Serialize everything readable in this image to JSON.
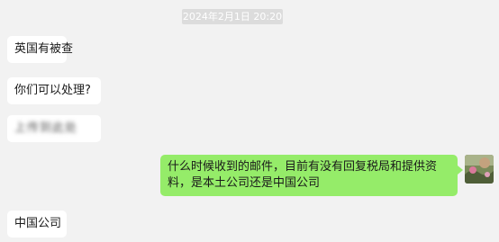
{
  "chat": {
    "timestamp": "2024年2月1日 20:20",
    "messages": [
      {
        "side": "incoming",
        "text": "英国有被查"
      },
      {
        "side": "incoming",
        "text": "你们可以处理?"
      },
      {
        "side": "incoming",
        "text": "上传到此处",
        "obscured": true
      },
      {
        "side": "outgoing",
        "text": "什么时候收到的邮件，目前有没有回复税局和提供资料，是本土公司还是中国公司"
      },
      {
        "side": "incoming",
        "text": "中国公司"
      }
    ]
  },
  "colors": {
    "background": "#f2f2f2",
    "incoming_bubble": "#ffffff",
    "outgoing_bubble": "#95ec69",
    "timestamp_bg": "#dcdcdc"
  },
  "icons": {
    "avatar": "user-avatar-photo"
  }
}
